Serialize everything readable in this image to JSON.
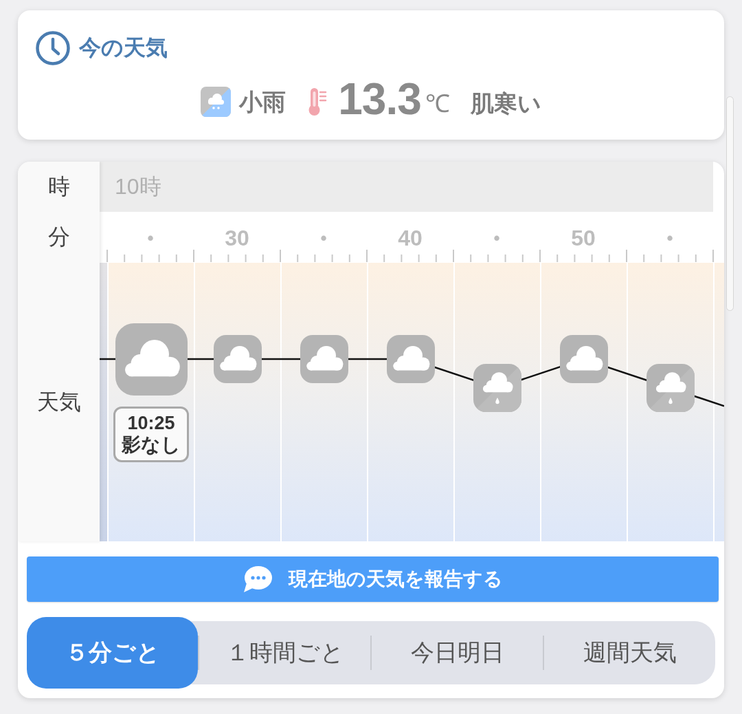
{
  "current_weather": {
    "title": "今の天気",
    "condition": "小雨",
    "temperature": "13.3",
    "unit": "℃",
    "feeling": "肌寒い"
  },
  "forecast": {
    "row_labels": [
      "時",
      "分",
      "天気"
    ],
    "hour": "10時",
    "slots": [
      {
        "minute": "•",
        "kind": "cloud",
        "selected": true,
        "callout": {
          "time": "10:25",
          "note": "影なし"
        }
      },
      {
        "minute": "30",
        "kind": "cloud",
        "selected": false
      },
      {
        "minute": "•",
        "kind": "cloud",
        "selected": false
      },
      {
        "minute": "40",
        "kind": "cloud",
        "selected": false
      },
      {
        "minute": "•",
        "kind": "light_rain",
        "selected": false
      },
      {
        "minute": "50",
        "kind": "cloud",
        "selected": false
      },
      {
        "minute": "•",
        "kind": "light_rain",
        "selected": false
      }
    ]
  },
  "report_button": {
    "label": "現在地の天気を報告する"
  },
  "tabs": [
    {
      "label": "５分ごと",
      "selected": true
    },
    {
      "label": "１時間ごと",
      "selected": false
    },
    {
      "label": "今日明日",
      "selected": false
    },
    {
      "label": "週間天気",
      "selected": false
    }
  ]
}
